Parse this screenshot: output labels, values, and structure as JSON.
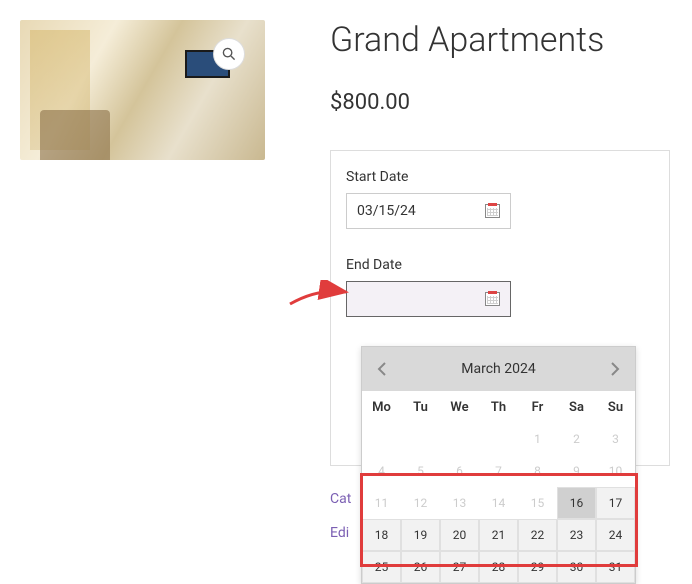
{
  "product": {
    "title": "Grand Apartments",
    "price": "$800.00"
  },
  "form": {
    "start_label": "Start Date",
    "start_value": "03/15/24",
    "end_label": "End Date",
    "end_value": ""
  },
  "meta": {
    "category_prefix": "Cat",
    "edit_label": "Edi"
  },
  "calendar": {
    "month_title": "March 2024",
    "weekdays": [
      "Mo",
      "Tu",
      "We",
      "Th",
      "Fr",
      "Sa",
      "Su"
    ],
    "rows": [
      [
        {
          "v": "",
          "s": "blank"
        },
        {
          "v": "",
          "s": "blank"
        },
        {
          "v": "",
          "s": "blank"
        },
        {
          "v": "",
          "s": "blank"
        },
        {
          "v": "1",
          "s": "disabled"
        },
        {
          "v": "2",
          "s": "disabled"
        },
        {
          "v": "3",
          "s": "disabled"
        }
      ],
      [
        {
          "v": "4",
          "s": "disabled"
        },
        {
          "v": "5",
          "s": "disabled"
        },
        {
          "v": "6",
          "s": "disabled"
        },
        {
          "v": "7",
          "s": "disabled"
        },
        {
          "v": "8",
          "s": "disabled"
        },
        {
          "v": "9",
          "s": "disabled"
        },
        {
          "v": "10",
          "s": "disabled"
        }
      ],
      [
        {
          "v": "11",
          "s": "disabled"
        },
        {
          "v": "12",
          "s": "disabled"
        },
        {
          "v": "13",
          "s": "disabled"
        },
        {
          "v": "14",
          "s": "disabled"
        },
        {
          "v": "15",
          "s": "disabled"
        },
        {
          "v": "16",
          "s": "enabled hover"
        },
        {
          "v": "17",
          "s": "enabled"
        }
      ],
      [
        {
          "v": "18",
          "s": "enabled"
        },
        {
          "v": "19",
          "s": "enabled"
        },
        {
          "v": "20",
          "s": "enabled"
        },
        {
          "v": "21",
          "s": "enabled"
        },
        {
          "v": "22",
          "s": "enabled"
        },
        {
          "v": "23",
          "s": "enabled"
        },
        {
          "v": "24",
          "s": "enabled"
        }
      ],
      [
        {
          "v": "25",
          "s": "enabled"
        },
        {
          "v": "26",
          "s": "enabled"
        },
        {
          "v": "27",
          "s": "enabled"
        },
        {
          "v": "28",
          "s": "enabled"
        },
        {
          "v": "29",
          "s": "enabled"
        },
        {
          "v": "30",
          "s": "enabled"
        },
        {
          "v": "31",
          "s": "enabled"
        }
      ]
    ]
  }
}
